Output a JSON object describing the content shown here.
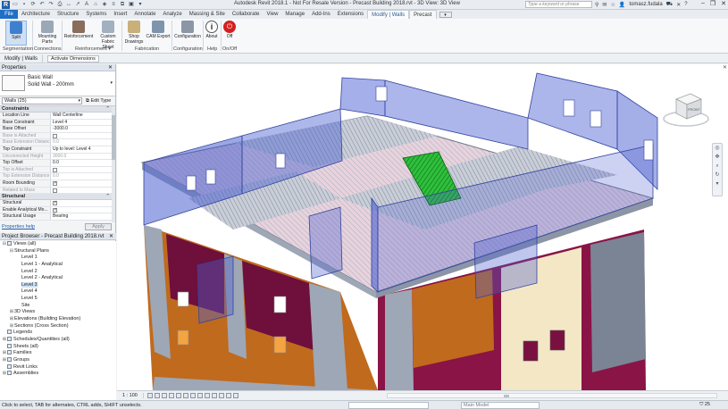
{
  "app": {
    "title": "Autodesk Revit 2018.1 - Not For Resale Version - Precast Building 2018.rvt - 3D View: 3D View",
    "search_placeholder": "Type a keyword or phrase",
    "user": "tomasz.fudala",
    "logo_letter": "R"
  },
  "tabs": [
    "File",
    "Architecture",
    "Structure",
    "Systems",
    "Insert",
    "Annotate",
    "Analyze",
    "Massing & Site",
    "Collaborate",
    "View",
    "Manage",
    "Add-Ins",
    "Extensions",
    "Modify | Walls",
    "Precast"
  ],
  "active_tab": "Modify | Walls",
  "ribbon": {
    "buttons": [
      {
        "label": "Split",
        "sublabel": ""
      },
      {
        "label": "Mounting",
        "sublabel": "Parts"
      },
      {
        "label": "Reinforcement",
        "sublabel": ""
      },
      {
        "label": "Custom",
        "sublabel": "Fabric Sheet"
      },
      {
        "label": "Shop",
        "sublabel": "Drawings"
      },
      {
        "label": "CAM Export",
        "sublabel": ""
      },
      {
        "label": "Configuration",
        "sublabel": ""
      },
      {
        "label": "About",
        "sublabel": ""
      },
      {
        "label": "Off",
        "sublabel": ""
      }
    ],
    "groups": [
      "Segmentation",
      "Connections",
      "Reinforcement ▾",
      "Fabrication",
      "Configuration",
      "Help",
      "On/Off"
    ]
  },
  "context_bar": {
    "label": "Modify | Walls",
    "button": "Activate Dimensions"
  },
  "properties": {
    "title": "Properties",
    "family": "Basic Wall",
    "type": "Solid Wall - 200mm",
    "instance": "Walls (25)",
    "edit_type": "Edit Type",
    "sections": [
      {
        "name": "Constraints",
        "rows": [
          {
            "name": "Location Line",
            "value": "Wall Centerline",
            "dim": false,
            "check": null
          },
          {
            "name": "Base Constraint",
            "value": "Level 4",
            "dim": false,
            "check": null
          },
          {
            "name": "Base Offset",
            "value": "-3000.0",
            "dim": false,
            "check": null
          },
          {
            "name": "Base is Attached",
            "value": "",
            "dim": true,
            "check": false
          },
          {
            "name": "Base Extension Distance",
            "value": "0.0",
            "dim": true,
            "check": null
          },
          {
            "name": "Top Constraint",
            "value": "Up to level: Level 4",
            "dim": false,
            "check": null
          },
          {
            "name": "Unconnected Height",
            "value": "3000.0",
            "dim": true,
            "check": null
          },
          {
            "name": "Top Offset",
            "value": "0.0",
            "dim": false,
            "check": null
          },
          {
            "name": "Top is Attached",
            "value": "",
            "dim": true,
            "check": false
          },
          {
            "name": "Top Extension Distance",
            "value": "0.0",
            "dim": true,
            "check": null
          },
          {
            "name": "Room Bounding",
            "value": "",
            "dim": false,
            "check": true
          },
          {
            "name": "Related to Mass",
            "value": "",
            "dim": true,
            "check": false
          }
        ]
      },
      {
        "name": "Structural",
        "rows": [
          {
            "name": "Structural",
            "value": "",
            "dim": false,
            "check": true
          },
          {
            "name": "Enable Analytical Mo...",
            "value": "",
            "dim": false,
            "check": true
          },
          {
            "name": "Structural Usage",
            "value": "Bearing",
            "dim": false,
            "check": null
          }
        ]
      }
    ],
    "help_link": "Properties help",
    "apply": "Apply"
  },
  "browser": {
    "title": "Project Browser - Precast Building 2018.rvt",
    "nodes": [
      {
        "label": "Views (all)",
        "indent": 0,
        "tog": "⊟",
        "icon": true,
        "current": false
      },
      {
        "label": "Structural Plans",
        "indent": 1,
        "tog": "⊟",
        "icon": false,
        "current": false
      },
      {
        "label": "Level 1",
        "indent": 2,
        "tog": "",
        "icon": false,
        "current": false
      },
      {
        "label": "Level 1 - Analytical",
        "indent": 2,
        "tog": "",
        "icon": false,
        "current": false
      },
      {
        "label": "Level 2",
        "indent": 2,
        "tog": "",
        "icon": false,
        "current": false
      },
      {
        "label": "Level 2 - Analytical",
        "indent": 2,
        "tog": "",
        "icon": false,
        "current": false
      },
      {
        "label": "Level 3",
        "indent": 2,
        "tog": "",
        "icon": false,
        "current": true
      },
      {
        "label": "Level 4",
        "indent": 2,
        "tog": "",
        "icon": false,
        "current": false
      },
      {
        "label": "Level 5",
        "indent": 2,
        "tog": "",
        "icon": false,
        "current": false
      },
      {
        "label": "Site",
        "indent": 2,
        "tog": "",
        "icon": false,
        "current": false
      },
      {
        "label": "3D Views",
        "indent": 1,
        "tog": "⊞",
        "icon": false,
        "current": false
      },
      {
        "label": "Elevations (Building Elevation)",
        "indent": 1,
        "tog": "⊞",
        "icon": false,
        "current": false
      },
      {
        "label": "Sections (Cross Section)",
        "indent": 1,
        "tog": "⊞",
        "icon": false,
        "current": false
      },
      {
        "label": "Legends",
        "indent": 0,
        "tog": "",
        "icon": true,
        "current": false
      },
      {
        "label": "Schedules/Quantities (all)",
        "indent": 0,
        "tog": "⊞",
        "icon": true,
        "current": false
      },
      {
        "label": "Sheets (all)",
        "indent": 0,
        "tog": "",
        "icon": true,
        "current": false
      },
      {
        "label": "Families",
        "indent": 0,
        "tog": "⊞",
        "icon": true,
        "current": false
      },
      {
        "label": "Groups",
        "indent": 0,
        "tog": "⊞",
        "icon": true,
        "current": false
      },
      {
        "label": "Revit Links",
        "indent": 0,
        "tog": "",
        "icon": true,
        "current": false
      },
      {
        "label": "Assemblies",
        "indent": 0,
        "tog": "⊞",
        "icon": true,
        "current": false
      }
    ]
  },
  "viewcube": {
    "face": "FRONT"
  },
  "view_control": {
    "scale": "1 : 100"
  },
  "status": {
    "message": "Click to select, TAB for alternates, CTRL adds, SHIFT unselects.",
    "workset": "",
    "model": "Main Model",
    "filter_count": "25"
  },
  "colors": {
    "file_tab": "#1f6fc4",
    "glass_wall": "#4a5fd0",
    "maroon_panel": "#7a1040",
    "orange_panel": "#c4701c",
    "stair": "#1ea82e"
  }
}
